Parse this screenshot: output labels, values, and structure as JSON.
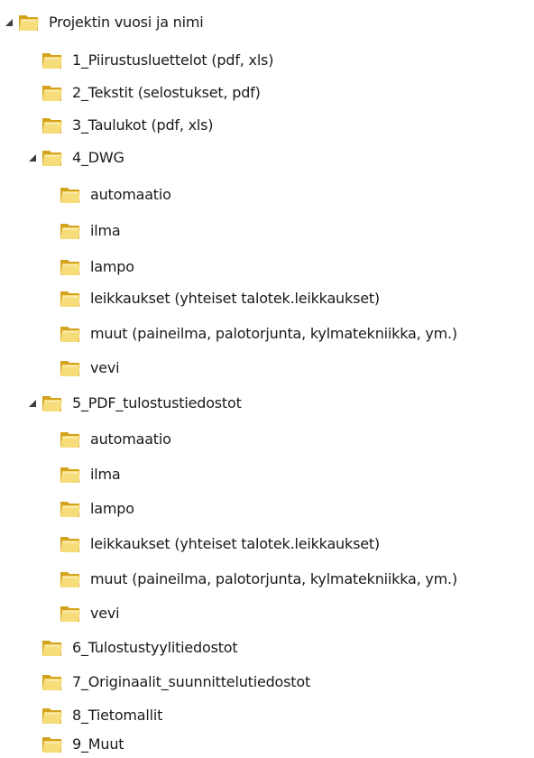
{
  "tree": {
    "root": {
      "label": "Projektin vuosi ja nimi",
      "expanded": true
    },
    "items": [
      {
        "label": "1_Piirustusluettelot (pdf, xls)"
      },
      {
        "label": "2_Tekstit (selostukset, pdf)"
      },
      {
        "label": "3_Taulukot (pdf, xls)"
      },
      {
        "label": "4_DWG",
        "expanded": true
      },
      {
        "label": "automaatio"
      },
      {
        "label": "ilma"
      },
      {
        "label": "lampo"
      },
      {
        "label": "leikkaukset (yhteiset talotek.leikkaukset)"
      },
      {
        "label": "muut (paineilma, palotorjunta, kylmatekniikka, ym.)"
      },
      {
        "label": "vevi"
      },
      {
        "label": "5_PDF_tulostustiedostot",
        "expanded": true
      },
      {
        "label": "automaatio"
      },
      {
        "label": "ilma"
      },
      {
        "label": "lampo"
      },
      {
        "label": "leikkaukset (yhteiset talotek.leikkaukset)"
      },
      {
        "label": "muut (paineilma, palotorjunta, kylmatekniikka, ym.)"
      },
      {
        "label": "vevi"
      },
      {
        "label": "6_Tulostustyylitiedostot"
      },
      {
        "label": "7_Originaalit_suunnittelutiedostot"
      },
      {
        "label": "8_Tietomallit"
      },
      {
        "label": "9_Muut"
      }
    ]
  },
  "icons": {
    "folder": "folder-icon",
    "expanded_arrow": "expanded-arrow-icon"
  },
  "colors": {
    "folder_light": "#f7dc7a",
    "folder_dark": "#d4a21c",
    "arrow": "#3c3c3c",
    "text": "#1a1a1a"
  }
}
